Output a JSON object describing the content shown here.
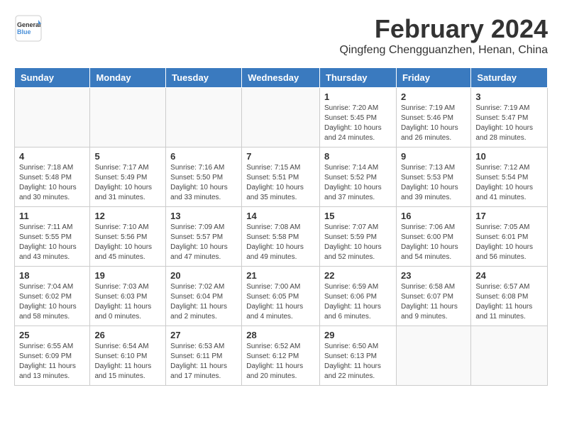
{
  "header": {
    "logo_general": "General",
    "logo_blue": "Blue",
    "month_year": "February 2024",
    "location": "Qingfeng Chengguanzhen, Henan, China"
  },
  "weekdays": [
    "Sunday",
    "Monday",
    "Tuesday",
    "Wednesday",
    "Thursday",
    "Friday",
    "Saturday"
  ],
  "weeks": [
    [
      {
        "day": "",
        "info": ""
      },
      {
        "day": "",
        "info": ""
      },
      {
        "day": "",
        "info": ""
      },
      {
        "day": "",
        "info": ""
      },
      {
        "day": "1",
        "info": "Sunrise: 7:20 AM\nSunset: 5:45 PM\nDaylight: 10 hours\nand 24 minutes."
      },
      {
        "day": "2",
        "info": "Sunrise: 7:19 AM\nSunset: 5:46 PM\nDaylight: 10 hours\nand 26 minutes."
      },
      {
        "day": "3",
        "info": "Sunrise: 7:19 AM\nSunset: 5:47 PM\nDaylight: 10 hours\nand 28 minutes."
      }
    ],
    [
      {
        "day": "4",
        "info": "Sunrise: 7:18 AM\nSunset: 5:48 PM\nDaylight: 10 hours\nand 30 minutes."
      },
      {
        "day": "5",
        "info": "Sunrise: 7:17 AM\nSunset: 5:49 PM\nDaylight: 10 hours\nand 31 minutes."
      },
      {
        "day": "6",
        "info": "Sunrise: 7:16 AM\nSunset: 5:50 PM\nDaylight: 10 hours\nand 33 minutes."
      },
      {
        "day": "7",
        "info": "Sunrise: 7:15 AM\nSunset: 5:51 PM\nDaylight: 10 hours\nand 35 minutes."
      },
      {
        "day": "8",
        "info": "Sunrise: 7:14 AM\nSunset: 5:52 PM\nDaylight: 10 hours\nand 37 minutes."
      },
      {
        "day": "9",
        "info": "Sunrise: 7:13 AM\nSunset: 5:53 PM\nDaylight: 10 hours\nand 39 minutes."
      },
      {
        "day": "10",
        "info": "Sunrise: 7:12 AM\nSunset: 5:54 PM\nDaylight: 10 hours\nand 41 minutes."
      }
    ],
    [
      {
        "day": "11",
        "info": "Sunrise: 7:11 AM\nSunset: 5:55 PM\nDaylight: 10 hours\nand 43 minutes."
      },
      {
        "day": "12",
        "info": "Sunrise: 7:10 AM\nSunset: 5:56 PM\nDaylight: 10 hours\nand 45 minutes."
      },
      {
        "day": "13",
        "info": "Sunrise: 7:09 AM\nSunset: 5:57 PM\nDaylight: 10 hours\nand 47 minutes."
      },
      {
        "day": "14",
        "info": "Sunrise: 7:08 AM\nSunset: 5:58 PM\nDaylight: 10 hours\nand 49 minutes."
      },
      {
        "day": "15",
        "info": "Sunrise: 7:07 AM\nSunset: 5:59 PM\nDaylight: 10 hours\nand 52 minutes."
      },
      {
        "day": "16",
        "info": "Sunrise: 7:06 AM\nSunset: 6:00 PM\nDaylight: 10 hours\nand 54 minutes."
      },
      {
        "day": "17",
        "info": "Sunrise: 7:05 AM\nSunset: 6:01 PM\nDaylight: 10 hours\nand 56 minutes."
      }
    ],
    [
      {
        "day": "18",
        "info": "Sunrise: 7:04 AM\nSunset: 6:02 PM\nDaylight: 10 hours\nand 58 minutes."
      },
      {
        "day": "19",
        "info": "Sunrise: 7:03 AM\nSunset: 6:03 PM\nDaylight: 11 hours\nand 0 minutes."
      },
      {
        "day": "20",
        "info": "Sunrise: 7:02 AM\nSunset: 6:04 PM\nDaylight: 11 hours\nand 2 minutes."
      },
      {
        "day": "21",
        "info": "Sunrise: 7:00 AM\nSunset: 6:05 PM\nDaylight: 11 hours\nand 4 minutes."
      },
      {
        "day": "22",
        "info": "Sunrise: 6:59 AM\nSunset: 6:06 PM\nDaylight: 11 hours\nand 6 minutes."
      },
      {
        "day": "23",
        "info": "Sunrise: 6:58 AM\nSunset: 6:07 PM\nDaylight: 11 hours\nand 9 minutes."
      },
      {
        "day": "24",
        "info": "Sunrise: 6:57 AM\nSunset: 6:08 PM\nDaylight: 11 hours\nand 11 minutes."
      }
    ],
    [
      {
        "day": "25",
        "info": "Sunrise: 6:55 AM\nSunset: 6:09 PM\nDaylight: 11 hours\nand 13 minutes."
      },
      {
        "day": "26",
        "info": "Sunrise: 6:54 AM\nSunset: 6:10 PM\nDaylight: 11 hours\nand 15 minutes."
      },
      {
        "day": "27",
        "info": "Sunrise: 6:53 AM\nSunset: 6:11 PM\nDaylight: 11 hours\nand 17 minutes."
      },
      {
        "day": "28",
        "info": "Sunrise: 6:52 AM\nSunset: 6:12 PM\nDaylight: 11 hours\nand 20 minutes."
      },
      {
        "day": "29",
        "info": "Sunrise: 6:50 AM\nSunset: 6:13 PM\nDaylight: 11 hours\nand 22 minutes."
      },
      {
        "day": "",
        "info": ""
      },
      {
        "day": "",
        "info": ""
      }
    ]
  ]
}
